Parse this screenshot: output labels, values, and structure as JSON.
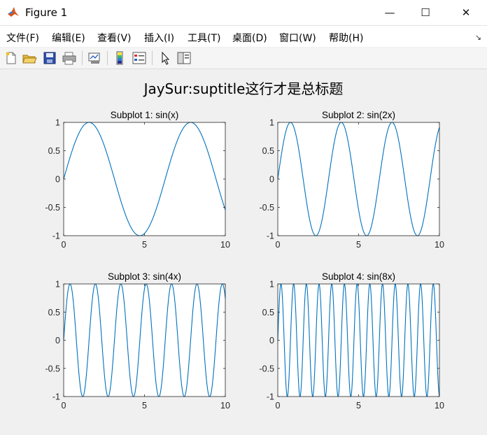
{
  "window": {
    "title": "Figure 1",
    "controls": {
      "minimize": "—",
      "maximize": "☐",
      "close": "✕"
    }
  },
  "menu": [
    {
      "label": "文件(F)"
    },
    {
      "label": "编辑(E)"
    },
    {
      "label": "查看(V)"
    },
    {
      "label": "插入(I)"
    },
    {
      "label": "工具(T)"
    },
    {
      "label": "桌面(D)"
    },
    {
      "label": "窗口(W)"
    },
    {
      "label": "帮助(H)"
    }
  ],
  "toolbar": [
    "new-figure-icon",
    "open-file-icon",
    "save-icon",
    "print-icon",
    "link-plot-icon",
    "insert-colorbar-icon",
    "insert-legend-icon",
    "edit-plot-arrow-icon",
    "property-inspector-icon"
  ],
  "colors": {
    "line": "#0072BD",
    "axes_bg": "#ffffff",
    "figure_bg": "#f0f0f0"
  },
  "suptitle": "JaySur:suptitle这行才是总标题",
  "chart_data": [
    {
      "type": "line",
      "title": "Subplot 1: sin(x)",
      "function": "sin(x)",
      "xlim": [
        0,
        10
      ],
      "ylim": [
        -1,
        1
      ],
      "xticks": [
        0,
        5,
        10
      ],
      "yticks": [
        -1,
        -0.5,
        0,
        0.5,
        1
      ],
      "xtick_labels": [
        "0",
        "5",
        "10"
      ],
      "ytick_labels": [
        "-1",
        "-0.5",
        "0",
        "0.5",
        "1"
      ],
      "frequency": 1,
      "grid": false
    },
    {
      "type": "line",
      "title": "Subplot 2: sin(2x)",
      "function": "sin(2x)",
      "xlim": [
        0,
        10
      ],
      "ylim": [
        -1,
        1
      ],
      "xticks": [
        0,
        5,
        10
      ],
      "yticks": [
        -1,
        -0.5,
        0,
        0.5,
        1
      ],
      "xtick_labels": [
        "0",
        "5",
        "10"
      ],
      "ytick_labels": [
        "-1",
        "-0.5",
        "0",
        "0.5",
        "1"
      ],
      "frequency": 2,
      "grid": false
    },
    {
      "type": "line",
      "title": "Subplot 3: sin(4x)",
      "function": "sin(4x)",
      "xlim": [
        0,
        10
      ],
      "ylim": [
        -1,
        1
      ],
      "xticks": [
        0,
        5,
        10
      ],
      "yticks": [
        -1,
        -0.5,
        0,
        0.5,
        1
      ],
      "xtick_labels": [
        "0",
        "5",
        "10"
      ],
      "ytick_labels": [
        "-1",
        "-0.5",
        "0",
        "0.5",
        "1"
      ],
      "frequency": 4,
      "grid": false
    },
    {
      "type": "line",
      "title": "Subplot 4: sin(8x)",
      "function": "sin(8x)",
      "xlim": [
        0,
        10
      ],
      "ylim": [
        -1,
        1
      ],
      "xticks": [
        0,
        5,
        10
      ],
      "yticks": [
        -1,
        -0.5,
        0,
        0.5,
        1
      ],
      "xtick_labels": [
        "0",
        "5",
        "10"
      ],
      "ytick_labels": [
        "-1",
        "-0.5",
        "0",
        "0.5",
        "1"
      ],
      "frequency": 8,
      "grid": false
    }
  ]
}
